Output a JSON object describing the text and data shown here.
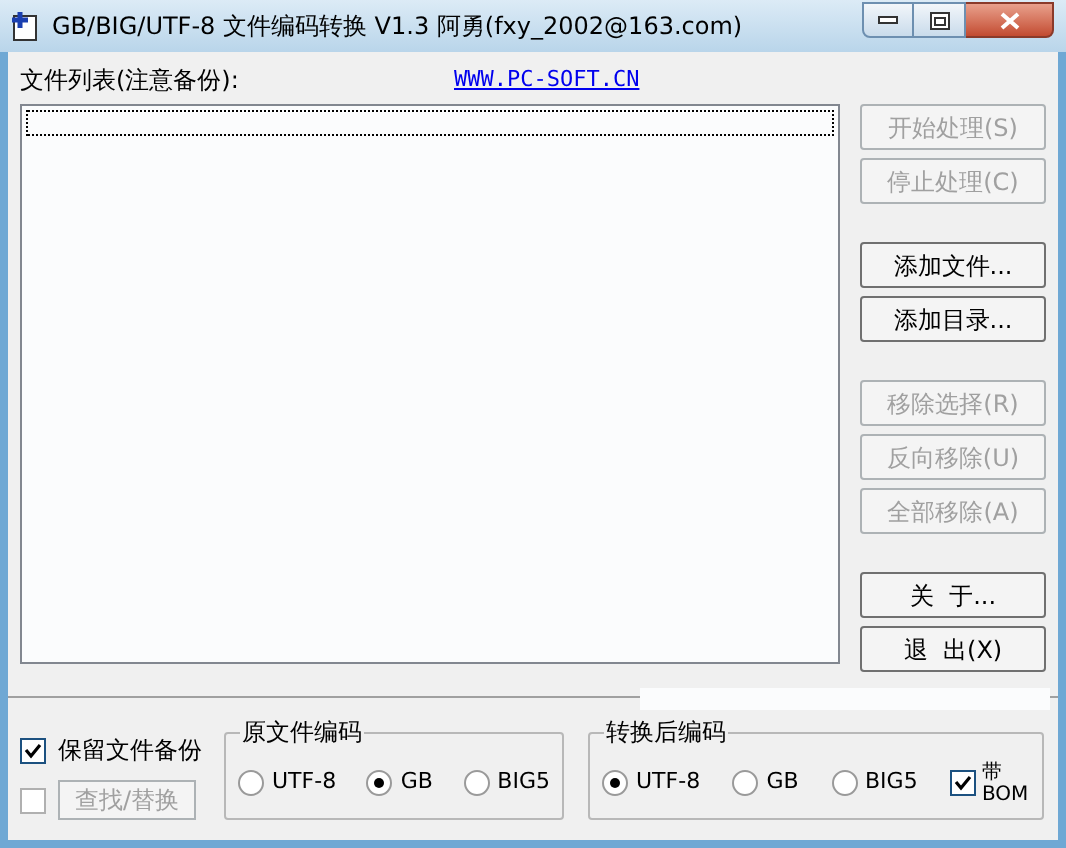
{
  "window": {
    "title": "GB/BIG/UTF-8 文件编码转换 V1.3  阿勇(fxy_2002@163.com)"
  },
  "file_list": {
    "label": "文件列表(注意备份):",
    "link": "WWW.PC-SOFT.CN"
  },
  "buttons": [
    {
      "label": "开始处理(S)",
      "disabled": true
    },
    {
      "label": "停止处理(C)",
      "disabled": true
    },
    {
      "label": "添加文件...",
      "disabled": false
    },
    {
      "label": "添加目录...",
      "disabled": false
    },
    {
      "label": "移除选择(R)",
      "disabled": true
    },
    {
      "label": "反向移除(U)",
      "disabled": true
    },
    {
      "label": "全部移除(A)",
      "disabled": true
    },
    {
      "label": "关  于...",
      "disabled": false
    },
    {
      "label": "退  出(X)",
      "disabled": false
    }
  ],
  "keep_backup": {
    "label": "保留文件备份",
    "checked": true
  },
  "find_replace": {
    "checked": false,
    "label": "查找/替换",
    "disabled": true
  },
  "source_encoding": {
    "title": "原文件编码",
    "options": [
      {
        "label": "UTF-8",
        "selected": false
      },
      {
        "label": "GB",
        "selected": true
      },
      {
        "label": "BIG5",
        "selected": false
      }
    ]
  },
  "target_encoding": {
    "title": "转换后编码",
    "options": [
      {
        "label": "UTF-8",
        "selected": true
      },
      {
        "label": "GB",
        "selected": false
      },
      {
        "label": "BIG5",
        "selected": false
      }
    ],
    "bom": {
      "label": "带 BOM",
      "checked": true
    }
  }
}
